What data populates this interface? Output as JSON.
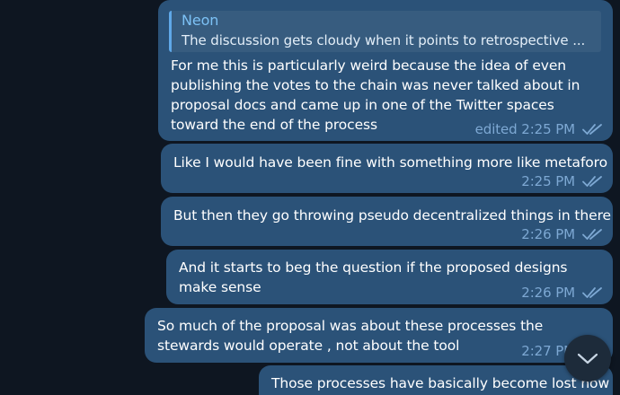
{
  "colors": {
    "background": "#0e1621",
    "bubble": "#2b5278",
    "text": "#ffffff",
    "meta": "#7da8d3",
    "reply_accent": "#5fa8e8",
    "reply_name": "#7cc1f5"
  },
  "messages": [
    {
      "reply": {
        "name": "Neon",
        "text": "The discussion gets cloudy when it points to retrospective ..."
      },
      "text": "For me this is particularly weird because the idea of even publishing the votes to the chain was never talked about in proposal docs and came up in one of the Twitter spaces toward the end of the process",
      "time": "edited 2:25 PM",
      "status_icon": "double-check-icon"
    },
    {
      "text": "Like I would have been fine with something more like metaforo",
      "time": "2:25 PM",
      "status_icon": "double-check-icon"
    },
    {
      "text": "But then they go throwing pseudo decentralized things in there",
      "time": "2:26 PM",
      "status_icon": "double-check-icon"
    },
    {
      "text": "And it starts to beg the question if the proposed designs make sense",
      "time": "2:26 PM",
      "status_icon": "double-check-icon"
    },
    {
      "text": "So much of the proposal was about these processes the stewards would operate , not about the tool",
      "time": "2:27 PM",
      "status_icon": "double-check-icon"
    },
    {
      "text": "Those processes have basically become lost now"
    }
  ],
  "scroll_button": {
    "icon": "chevron-down-icon"
  }
}
